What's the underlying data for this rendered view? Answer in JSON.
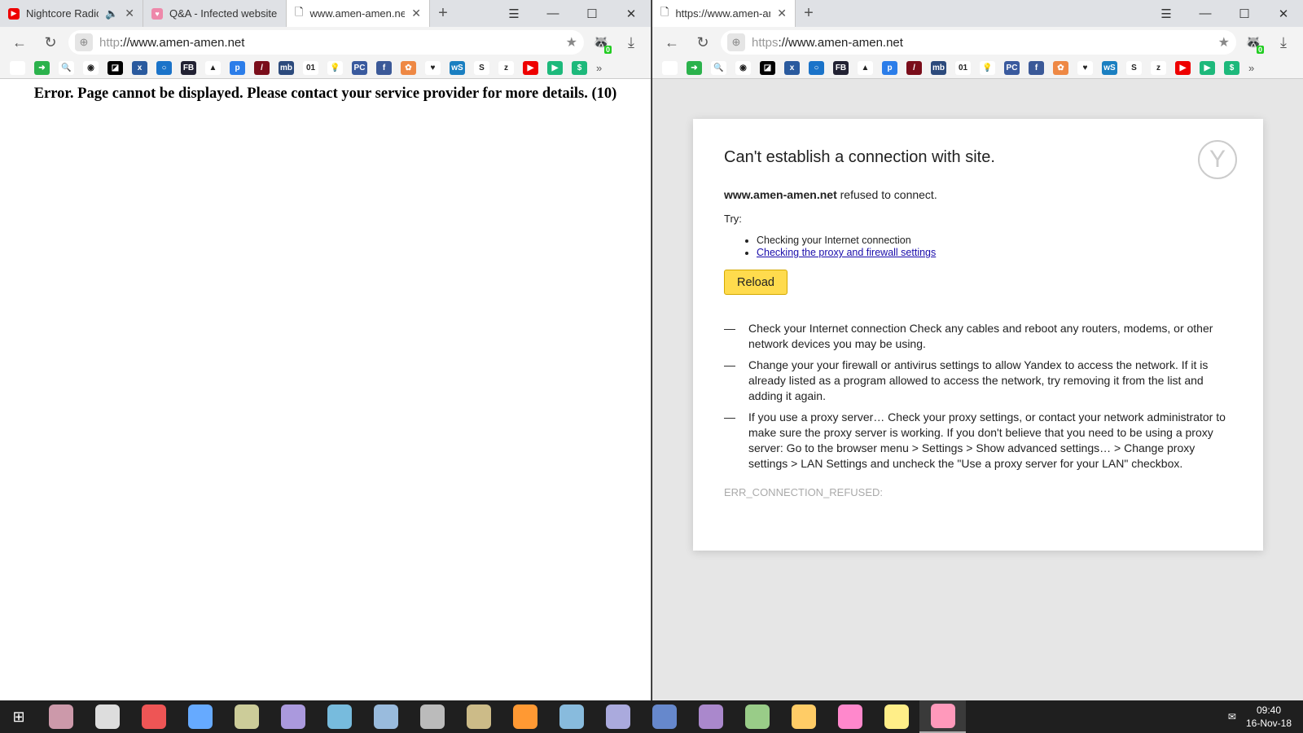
{
  "left": {
    "tabs": [
      {
        "title": "Nightcore Radio",
        "icon": "youtube-icon",
        "audio": true
      },
      {
        "title": "Q&A - Infected website",
        "icon": "yandex-qa-icon"
      },
      {
        "title": "www.amen-amen.net",
        "icon": "page-icon",
        "active": true
      }
    ],
    "url_scheme": "http",
    "url_rest": "://www.amen-amen.net",
    "extension_badge": "0",
    "error_text": "Error. Page cannot be displayed. Please contact your service provider for more details. (10)"
  },
  "right": {
    "tabs": [
      {
        "title": "https://www.amen-amen.net",
        "icon": "page-icon",
        "active": true
      }
    ],
    "url_scheme": "https",
    "url_rest": "://www.amen-amen.net",
    "extension_badge": "0",
    "title": "Can't establish a connection with site.",
    "host": "www.amen-amen.net",
    "refused": " refused to connect.",
    "try_label": "Try:",
    "suggestions": [
      "Checking your Internet connection",
      "Checking the proxy and firewall settings"
    ],
    "reload_label": "Reload",
    "dash": "—",
    "steps": [
      "Check your Internet connection Check any cables and reboot any routers, modems, or other network devices you may be using.",
      "Change your your firewall or antivirus settings to allow Yandex to access the network. If it is already listed as a program allowed to access the network, try removing it from the list and adding it again.",
      "If you use a proxy server… Check your proxy settings, or contact your network administrator to make sure the proxy server is working. If you don't believe that you need to be using a proxy server: Go to the browser menu > Settings > Show advanced settings… > Change proxy settings > LAN Settings and uncheck the \"Use a proxy server for your LAN\" checkbox."
    ],
    "error_code": "ERR_CONNECTION_REFUSED:"
  },
  "bookmarks": [
    {
      "name": "page",
      "color": "#fff",
      "glyph": ""
    },
    {
      "name": "arrow",
      "color": "#2bb24c",
      "glyph": "➜"
    },
    {
      "name": "magnifier",
      "color": "#fff",
      "glyph": "🔍"
    },
    {
      "name": "location",
      "color": "#fff",
      "glyph": "◉"
    },
    {
      "name": "amd",
      "color": "#000",
      "glyph": "◪"
    },
    {
      "name": "xda",
      "color": "#2a5a9e",
      "glyph": "x"
    },
    {
      "name": "search",
      "color": "#1a73c9",
      "glyph": "○"
    },
    {
      "name": "fb-dark",
      "color": "#223",
      "glyph": "FB"
    },
    {
      "name": "triangle",
      "color": "#fff",
      "glyph": "▲"
    },
    {
      "name": "p",
      "color": "#2b7de9",
      "glyph": "p"
    },
    {
      "name": "wine",
      "color": "#7a0d1a",
      "glyph": "/"
    },
    {
      "name": "mb",
      "color": "#2c4a7c",
      "glyph": "mb"
    },
    {
      "name": "binary",
      "color": "#fff",
      "glyph": "01"
    },
    {
      "name": "bulb",
      "color": "#fff",
      "glyph": "💡"
    },
    {
      "name": "pc",
      "color": "#3a5a9e",
      "glyph": "PC"
    },
    {
      "name": "facebook",
      "color": "#3b5998",
      "glyph": "f"
    },
    {
      "name": "colors",
      "color": "#e84",
      "glyph": "✿"
    },
    {
      "name": "yandex-qa",
      "color": "#fff",
      "glyph": "♥"
    },
    {
      "name": "ws",
      "color": "#1a7fc1",
      "glyph": "wS"
    },
    {
      "name": "s",
      "color": "#fff",
      "glyph": "S"
    },
    {
      "name": "z",
      "color": "#fff",
      "glyph": "z"
    },
    {
      "name": "youtube",
      "color": "#e00",
      "glyph": "▶"
    },
    {
      "name": "play",
      "color": "#1db97b",
      "glyph": "▶"
    },
    {
      "name": "dollar",
      "color": "#1db97b",
      "glyph": "$"
    }
  ],
  "taskbar": {
    "apps": [
      "#c9a",
      "#ddd",
      "#e55",
      "#6af",
      "#cc9",
      "#a9d",
      "#7bd",
      "#9bd",
      "#bbb",
      "#cb8",
      "#f93",
      "#8bd",
      "#aad",
      "#68c",
      "#a8c",
      "#9c8",
      "#fc6",
      "#f8c",
      "#fe8",
      "#f9b"
    ],
    "time": "09:40",
    "date": "16-Nov-18",
    "accent": "#ffdb4d"
  }
}
